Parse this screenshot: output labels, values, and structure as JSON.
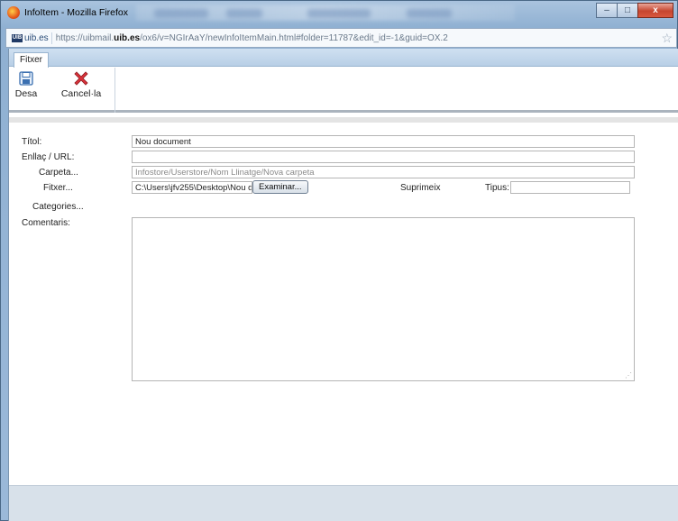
{
  "window": {
    "title": "InfoItem - Mozilla Firefox",
    "close_glyph": "x",
    "minimize_glyph": "–",
    "maximize_glyph": "□"
  },
  "urlbar": {
    "site": "uib.es",
    "site_badge_text": "UIB",
    "url_prefix": "https://uibmail.",
    "url_domain": "uib.es",
    "url_suffix": "/ox6/v=NGIrAaY/newInfoItemMain.html#folder=11787&edit_id=-1&guid=OX.2"
  },
  "tabs": [
    {
      "label": "Fitxer"
    }
  ],
  "toolbar": {
    "save_label": "Desa",
    "cancel_label": "Cancel·la",
    "save_icon": "floppy-disk-icon",
    "cancel_icon": "red-x-icon"
  },
  "form": {
    "title_label": "Títol:",
    "title_value": "Nou document",
    "link_label": "Enllaç / URL:",
    "link_value": "",
    "folder_label": "Carpeta...",
    "folder_value": "Infostore/Userstore/Nom Llinatge/Nova carpeta",
    "file_label": "Fitxer...",
    "file_value": "C:\\Users\\jfv255\\Desktop\\Nou doc",
    "browse_label": "Examinar...",
    "delete_label": "Suprimeix",
    "type_label": "Tipus:",
    "type_value": "",
    "categories_label": "Categories...",
    "comments_label": "Comentaris:",
    "comments_value": ""
  },
  "colors": {
    "accent": "#99b4d0",
    "cancel_red": "#d9323a",
    "save_blue": "#3a6fb0"
  }
}
